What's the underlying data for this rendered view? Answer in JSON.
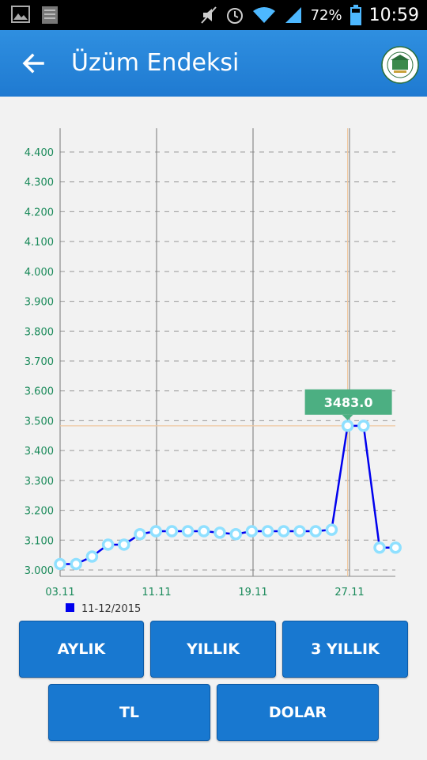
{
  "status_bar": {
    "battery": "72%",
    "time": "10:59",
    "icons": [
      "image-icon",
      "storage-icon",
      "mute-icon",
      "alarm-icon",
      "wifi-icon",
      "signal-icon",
      "battery-icon"
    ]
  },
  "app_bar": {
    "title": "Üzüm Endeksi",
    "back_icon": "arrow-left-icon",
    "logo_icon": "chamber-logo-icon"
  },
  "chart_data": {
    "type": "line",
    "ylim": [
      3000,
      4400
    ],
    "yticks": [
      "3.000",
      "3.100",
      "3.200",
      "3.300",
      "3.400",
      "3.500",
      "3.600",
      "3.700",
      "3.800",
      "3.900",
      "4.000",
      "4.100",
      "4.200",
      "4.300",
      "4.400"
    ],
    "xticks": [
      "03.11",
      "11.11",
      "19.11",
      "27.11"
    ],
    "series": [
      {
        "name": "11-12/2015",
        "color": "#0000ee",
        "values": [
          3020,
          3020,
          3045,
          3085,
          3085,
          3120,
          3130,
          3130,
          3130,
          3130,
          3125,
          3120,
          3130,
          3130,
          3130,
          3130,
          3130,
          3135,
          3483,
          3483,
          3075,
          3075
        ]
      }
    ],
    "highlight": {
      "index": 18,
      "label": "3483.0"
    },
    "grid": true,
    "legend": "bottom-left"
  },
  "buttons": {
    "monthly": "AYLIK",
    "yearly": "YILLIK",
    "three_year": "3 YILLIK",
    "tl": "TL",
    "dollar": "DOLAR"
  },
  "colors": {
    "accent": "#1878d0",
    "appbar": "#2585d9",
    "axis_label": "#1a8a5a",
    "line": "#0000ee",
    "tooltip": "#4caf82",
    "crosshair": "#f0c8a0"
  }
}
